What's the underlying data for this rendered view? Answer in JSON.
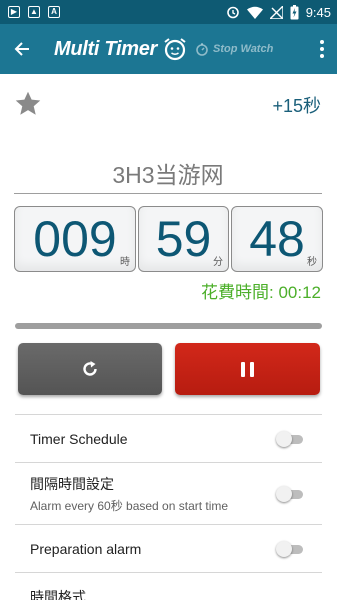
{
  "status_bar": {
    "time": "9:45",
    "icons": [
      "play-icon",
      "image-icon",
      "a-icon",
      "alarm-clock-icon",
      "wifi-icon",
      "no-signal-icon",
      "battery-charging-icon"
    ]
  },
  "app_bar": {
    "title": "Multi Timer",
    "stopwatch_label": "Stop Watch",
    "icons": [
      "back-arrow-icon",
      "alarm-clock-logo-icon",
      "stopwatch-icon",
      "overflow-menu-icon"
    ]
  },
  "timer": {
    "add_time_label": "+15秒",
    "name": "3H3当游网",
    "hours": "009",
    "hours_unit": "時",
    "minutes": "59",
    "minutes_unit": "分",
    "seconds": "48",
    "seconds_unit": "秒",
    "elapsed_label": "花費時間: 00:12",
    "progress": 0.0
  },
  "settings": [
    {
      "label": "Timer Schedule",
      "enabled": false
    },
    {
      "label": "間隔時間設定",
      "sub": "Alarm every 60秒 based on start time",
      "enabled": false
    },
    {
      "label": "Preparation alarm",
      "enabled": false
    },
    {
      "label": "時間格式"
    }
  ],
  "colors": {
    "status_bar": "#0e5a73",
    "app_bar": "#1c7693",
    "digits": "#0d5774",
    "elapsed": "#4caf2a",
    "pause_button": "#c62314",
    "reset_button": "#5f5f5f"
  }
}
